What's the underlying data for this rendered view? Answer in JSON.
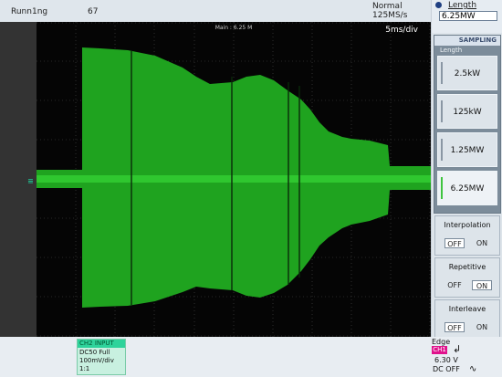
{
  "top_bar": {
    "run_status": "Runn1ng",
    "record_count": "67",
    "acquisition_mode": "Normal",
    "sample_rate": "125MS/s"
  },
  "screen": {
    "main_label": "Main : 6.25 M",
    "time_div": "5ms/div",
    "channel_marker": "≡",
    "trace_color": "#1fa31f"
  },
  "length_header": {
    "title": "Length",
    "value": "6.25MW"
  },
  "sampling_menu": {
    "title": "SAMPLING",
    "subtitle": "Length",
    "options": [
      {
        "label": "2.5kW",
        "selected": false
      },
      {
        "label": "125kW",
        "selected": false
      },
      {
        "label": "1.25MW",
        "selected": false
      },
      {
        "label": "6.25MW",
        "selected": true
      }
    ]
  },
  "settings": {
    "interpolation": {
      "title": "Interpolation",
      "off": "OFF",
      "on": "ON",
      "value": "OFF"
    },
    "repetitive": {
      "title": "Repetitive",
      "off": "OFF",
      "on": "ON",
      "value": "ON"
    },
    "interleave": {
      "title": "Interleave",
      "off": "OFF",
      "on": "ON",
      "value": "OFF"
    }
  },
  "channel_info": {
    "title": "CH2  INPUT",
    "coupling": "DC50 Full",
    "scale": "100mV/div",
    "probe": "1:1"
  },
  "trigger": {
    "type": "Edge",
    "source": "CH1",
    "slope_icon": "rising-edge-icon",
    "level": "6.30 V",
    "coupling": "DC OFF",
    "noise_icon": "noise-reject-icon"
  }
}
